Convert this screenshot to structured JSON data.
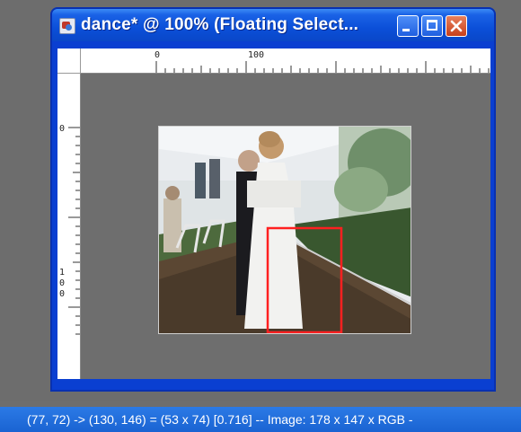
{
  "window": {
    "title": "dance* @ 100% (Floating Select...",
    "icon": "paint-shop-icon"
  },
  "rulers": {
    "horizontal_labels": [
      "0",
      "100"
    ],
    "vertical_labels": [
      "0",
      "1",
      "0",
      "0"
    ]
  },
  "selection": {
    "color": "#ff2020"
  },
  "status_bar": {
    "text": "(77, 72) -> (130, 146) = (53 x 74) [0.716] -- Image:  178 x 147 x RGB -"
  },
  "colors": {
    "titlebar": "#0b4fd8",
    "workspace": "#6e6e6e",
    "statusbar": "#1a63d2"
  }
}
